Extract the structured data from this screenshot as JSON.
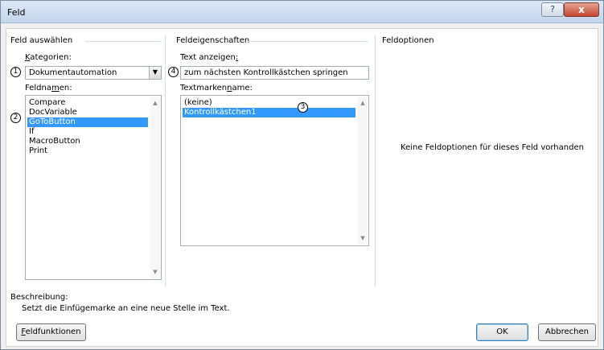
{
  "window": {
    "title": "Feld",
    "help_glyph": "?",
    "close_glyph": "x"
  },
  "left": {
    "section_title": "Feld auswählen",
    "kategorien_prefix": "",
    "kategorien_ul": "K",
    "kategorien_rest": "ategorien:",
    "kategorien_value": "Dokumentautomation",
    "combo_arrow": "▼",
    "feldnamen_prefix": "Feldna",
    "feldnamen_ul": "m",
    "feldnamen_rest": "en:",
    "items": [
      "Compare",
      "DocVariable",
      "GoToButton",
      "If",
      "MacroButton",
      "Print"
    ],
    "selected_index": 2
  },
  "middle": {
    "section_title": "Feldeigenschaften",
    "text_label_prefix": "Text anzeigen",
    "text_label_ul": ":",
    "text_value": "zum nächsten Kontrollkästchen springen",
    "textmarke_prefix": "Textmarken",
    "textmarke_ul": "n",
    "textmarke_rest": "ame:",
    "items": [
      "(keine)",
      "Kontrollkästchen1"
    ],
    "selected_index": 1
  },
  "right": {
    "section_title": "Feldoptionen",
    "message": "Keine Feldoptionen für dieses Feld vorhanden"
  },
  "description": {
    "label": "Beschreibung:",
    "text": "Setzt die Einfügemarke an eine neue Stelle im Text."
  },
  "buttons": {
    "feldfunktionen_ul": "F",
    "feldfunktionen_rest": "eldfunktionen",
    "ok": "OK",
    "cancel": "Abbrechen"
  },
  "markers": [
    "1",
    "2",
    "3",
    "4"
  ],
  "scroll": {
    "up": "▲",
    "down": "▼"
  }
}
